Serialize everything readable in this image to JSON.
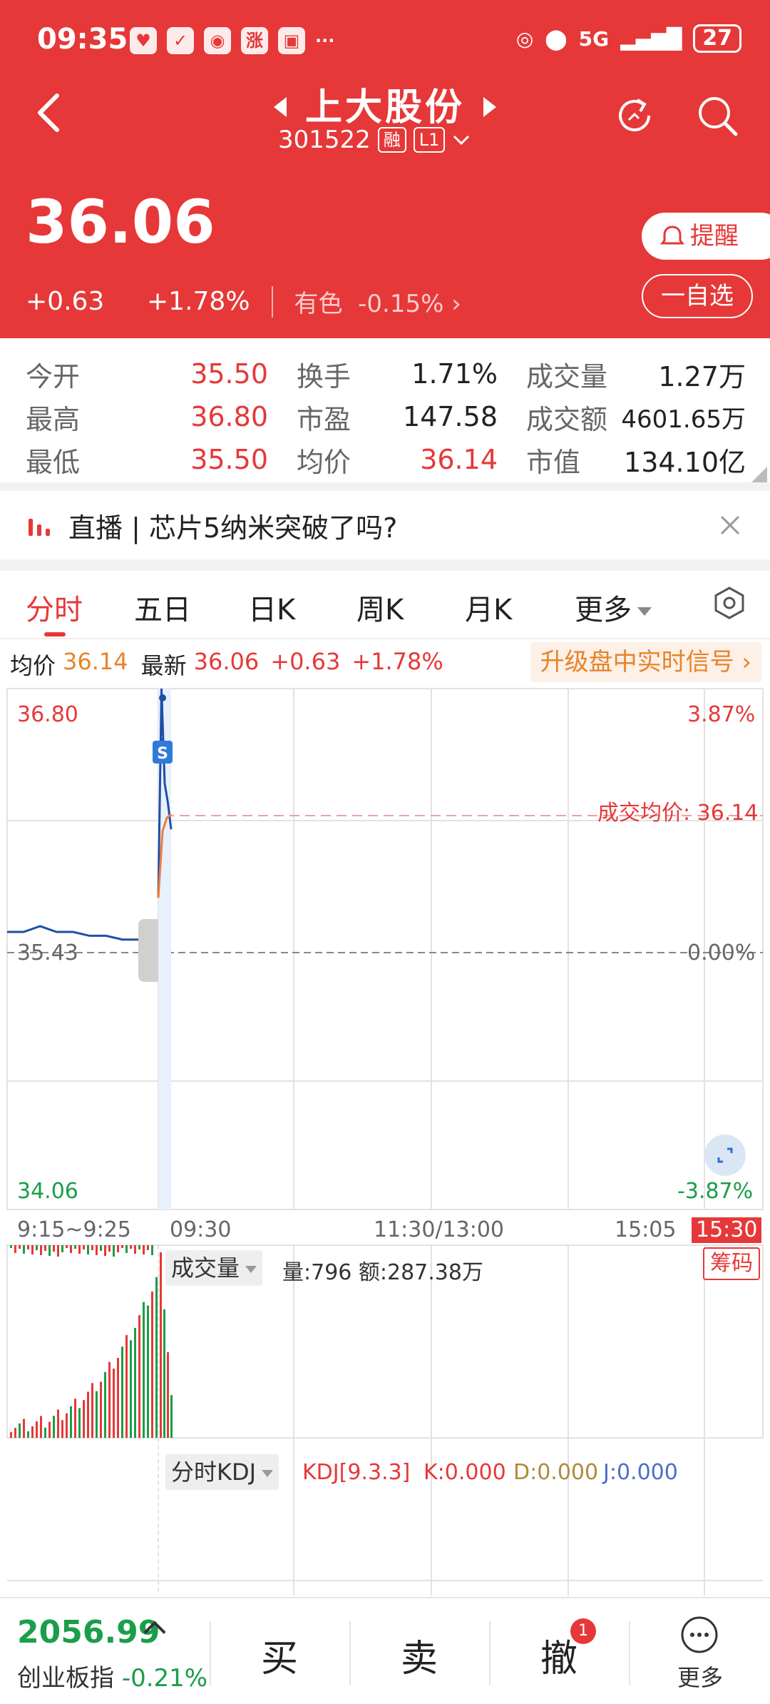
{
  "status_bar": {
    "time": "09:35",
    "battery": "27",
    "network": "5G"
  },
  "header": {
    "stock_name": "上大股份",
    "stock_code": "301522",
    "margin_tag": "融",
    "level_tag": "L1",
    "price": "36.06",
    "change": "+0.63",
    "change_pct": "+1.78%",
    "sector_name": "有色",
    "sector_change": "-0.15%",
    "alert_label": "提醒",
    "watchlist_label": "一自选"
  },
  "stats": {
    "rows": [
      [
        {
          "label": "今开",
          "value": "35.50"
        },
        {
          "label": "换手",
          "value": "1.71%"
        },
        {
          "label": "成交量",
          "value": "1.27万"
        }
      ],
      [
        {
          "label": "最高",
          "value": "36.80"
        },
        {
          "label": "市盈",
          "value": "147.58"
        },
        {
          "label": "成交额",
          "value": "4601.65万"
        }
      ],
      [
        {
          "label": "最低",
          "value": "35.50"
        },
        {
          "label": "均价",
          "value": "36.14"
        },
        {
          "label": "市值",
          "value": "134.10亿"
        }
      ]
    ]
  },
  "live_banner": {
    "text": "直播 | 芯片5纳米突破了吗?"
  },
  "tabs": [
    {
      "label": "分时"
    },
    {
      "label": "五日"
    },
    {
      "label": "日K"
    },
    {
      "label": "周K"
    },
    {
      "label": "月K"
    },
    {
      "label": "更多"
    }
  ],
  "info": {
    "avg_label": "均价",
    "avg_value": "36.14",
    "latest_label": "最新",
    "latest_value": "36.06",
    "change": "+0.63",
    "change_pct": "+1.78%",
    "upgrade_label": "升级盘中实时信号 ›"
  },
  "chart_data": {
    "type": "line",
    "y_max": "36.80",
    "y_mid": "35.43",
    "y_min": "34.06",
    "pct_max": "3.87%",
    "pct_mid": "0.00%",
    "pct_min": "-3.87%",
    "avg_line_label": "成交均价: 36.14",
    "signal_marker": "S",
    "time_labels": [
      "9:15~9:25",
      "09:30",
      "11:30/13:00",
      "15:05",
      "15:30"
    ],
    "ylim": [
      34.06,
      36.8
    ],
    "preopen_price": [
      35.52,
      35.52,
      35.55,
      35.52,
      35.52,
      35.5,
      35.5,
      35.48,
      35.48,
      35.52
    ],
    "price": [
      35.7,
      36.8,
      36.3,
      36.2,
      36.06
    ],
    "avg_price": [
      35.7,
      36.05,
      36.12,
      36.14
    ],
    "volume_label": "成交量",
    "volume_info": "量:796 额:287.38万",
    "chips_label": "筹码",
    "kdj_label": "分时KDJ",
    "kdj_params": "KDJ[9.3.3]",
    "kdj_k": "K:0.000",
    "kdj_d": "D:0.000",
    "kdj_j": "J:0.000"
  },
  "bottom_bar": {
    "index_value": "2056.99",
    "index_name": "创业板指",
    "index_change": "-0.21%",
    "buy_label": "买",
    "sell_label": "卖",
    "cancel_label": "撤",
    "cancel_badge": "1",
    "more_label": "更多"
  }
}
